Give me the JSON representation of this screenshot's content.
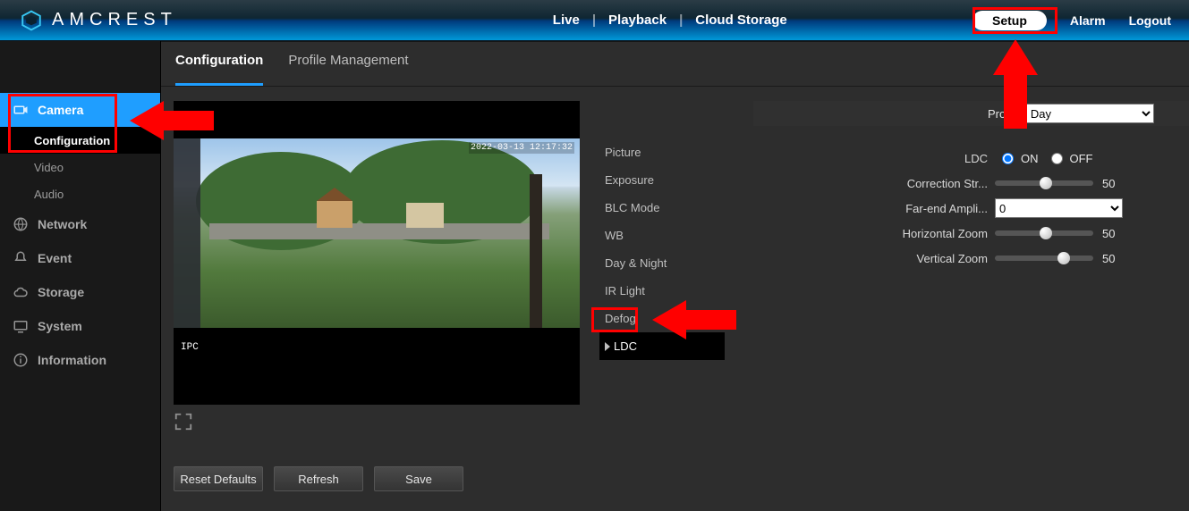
{
  "brand": "AMCREST",
  "header_nav": {
    "live": "Live",
    "playback": "Playback",
    "cloud": "Cloud Storage"
  },
  "header_right": {
    "setup": "Setup",
    "alarm": "Alarm",
    "logout": "Logout"
  },
  "sidebar": {
    "camera": {
      "label": "Camera",
      "configuration": "Configuration",
      "video": "Video",
      "audio": "Audio"
    },
    "network": "Network",
    "event": "Event",
    "storage": "Storage",
    "system": "System",
    "information": "Information"
  },
  "tabs": {
    "configuration": "Configuration",
    "profile_mgmt": "Profile Management"
  },
  "video": {
    "ipc_label": "IPC",
    "timestamp": "2022-03-13 12:17:32"
  },
  "buttons": {
    "reset": "Reset Defaults",
    "refresh": "Refresh",
    "save": "Save"
  },
  "pic_tabs": {
    "picture": "Picture",
    "exposure": "Exposure",
    "blc": "BLC Mode",
    "wb": "WB",
    "daynight": "Day & Night",
    "ir": "IR Light",
    "defog": "Defog",
    "ldc": "LDC"
  },
  "profile": {
    "label": "Profile",
    "selected": "Day"
  },
  "ldc": {
    "label": "LDC",
    "on": "ON",
    "off": "OFF",
    "correction_label": "Correction Str...",
    "correction_value": "50",
    "far_end_label": "Far-end Ampli...",
    "far_end_value": "0",
    "hzoom_label": "Horizontal Zoom",
    "hzoom_value": "50",
    "vzoom_label": "Vertical Zoom",
    "vzoom_value": "50"
  }
}
